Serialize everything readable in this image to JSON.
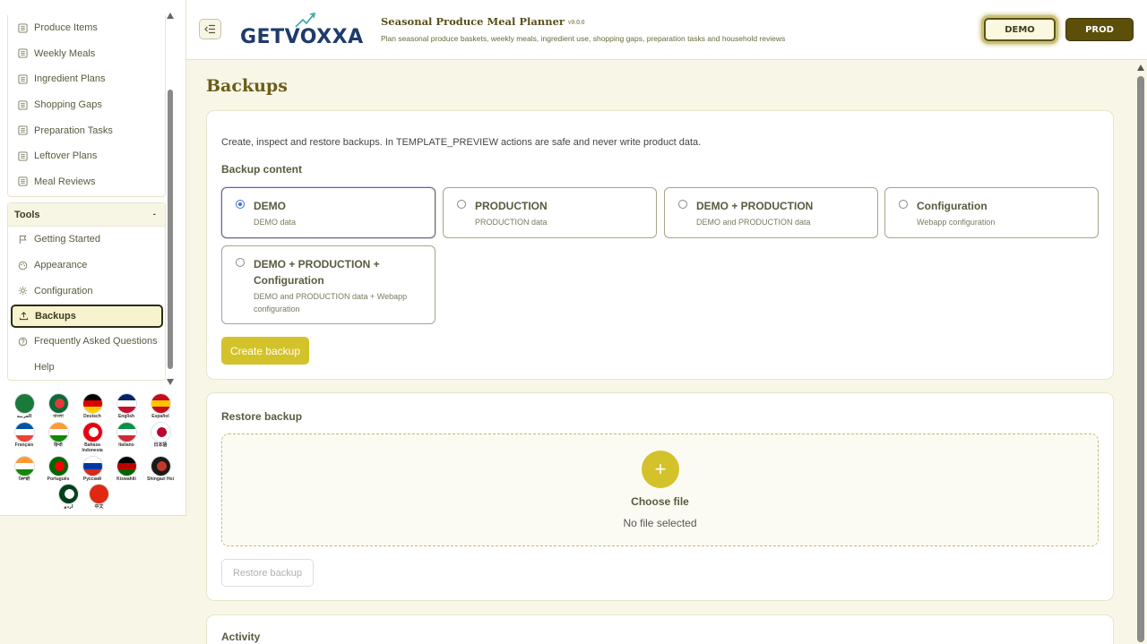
{
  "app": {
    "logo_text": "GETVOXXA",
    "title": "Seasonal Produce Meal Planner",
    "version": "v9.0.0",
    "subtitle": "Plan seasonal produce baskets, weekly meals, ingredient use, shopping gaps, preparation tasks and household reviews"
  },
  "env": {
    "demo": "DEMO",
    "prod": "PROD",
    "active": "DEMO"
  },
  "sidebar": {
    "top_items": [
      {
        "label": "Produce Items",
        "icon": "list-icon"
      },
      {
        "label": "Weekly Meals",
        "icon": "list-icon"
      },
      {
        "label": "Ingredient Plans",
        "icon": "list-icon"
      },
      {
        "label": "Shopping Gaps",
        "icon": "list-icon"
      },
      {
        "label": "Preparation Tasks",
        "icon": "list-icon"
      },
      {
        "label": "Leftover Plans",
        "icon": "list-icon"
      },
      {
        "label": "Meal Reviews",
        "icon": "list-icon"
      }
    ],
    "tools": {
      "title": "Tools",
      "collapse": "-",
      "items": [
        {
          "label": "Getting Started",
          "icon": "flag-icon"
        },
        {
          "label": "Appearance",
          "icon": "palette-icon"
        },
        {
          "label": "Configuration",
          "icon": "gear-icon"
        },
        {
          "label": "Backups",
          "icon": "upload-icon",
          "active": true
        },
        {
          "label": "Frequently Asked Questions",
          "icon": "question-icon"
        },
        {
          "label": "Help",
          "icon": ""
        }
      ]
    }
  },
  "languages": [
    {
      "label": "العربية",
      "colors": [
        "#1a7a3a",
        "#1a7a3a"
      ]
    },
    {
      "label": "বাংলা",
      "colors": [
        "#0a6a3a",
        "#e23a3a"
      ]
    },
    {
      "label": "Deutsch",
      "colors": [
        "#000000",
        "#dd0000",
        "#ffce00"
      ]
    },
    {
      "label": "English",
      "colors": [
        "#012169",
        "#ffffff",
        "#c8102e"
      ]
    },
    {
      "label": "Español",
      "colors": [
        "#c60b1e",
        "#ffc400",
        "#c60b1e"
      ]
    },
    {
      "label": "Français",
      "colors": [
        "#0055a4",
        "#ffffff",
        "#ef4135"
      ]
    },
    {
      "label": "हिन्दी",
      "colors": [
        "#ff9933",
        "#ffffff",
        "#138808"
      ]
    },
    {
      "label": "Bahasa Indonesia",
      "colors": [
        "#e70011",
        "#ffffff"
      ]
    },
    {
      "label": "Italiano",
      "colors": [
        "#009246",
        "#ffffff",
        "#ce2b37"
      ]
    },
    {
      "label": "日本語",
      "colors": [
        "#ffffff",
        "#bc002d"
      ]
    },
    {
      "label": "ਪੰਜਾਬੀ",
      "colors": [
        "#ff9933",
        "#ffffff",
        "#138808"
      ]
    },
    {
      "label": "Português",
      "colors": [
        "#006600",
        "#ff0000"
      ]
    },
    {
      "label": "Русский",
      "colors": [
        "#ffffff",
        "#0039a6",
        "#d52b1e"
      ]
    },
    {
      "label": "Kiswahili",
      "colors": [
        "#000000",
        "#bb0000",
        "#006600"
      ]
    },
    {
      "label": "Shingazi Hoi",
      "colors": [
        "#1a1a1a",
        "#c0392b"
      ]
    },
    {
      "label": "اردو",
      "colors": [
        "#01411c",
        "#ffffff"
      ]
    },
    {
      "label": "中文",
      "colors": [
        "#de2910",
        "#de2910"
      ]
    }
  ],
  "page": {
    "title": "Backups",
    "intro": "Create, inspect and restore backups. In TEMPLATE_PREVIEW actions are safe and never write product data.",
    "backup_content_title": "Backup content",
    "options": [
      {
        "title": "DEMO",
        "desc": "DEMO data",
        "selected": true
      },
      {
        "title": "PRODUCTION",
        "desc": "PRODUCTION data",
        "selected": false
      },
      {
        "title": "DEMO + PRODUCTION",
        "desc": "DEMO and PRODUCTION data",
        "selected": false
      },
      {
        "title": "Configuration",
        "desc": "Webapp configuration",
        "selected": false
      },
      {
        "title": "DEMO + PRODUCTION + Configuration",
        "desc": "DEMO and PRODUCTION data + Webapp configuration",
        "selected": false
      }
    ],
    "create_label": "Create backup",
    "restore_title": "Restore backup",
    "choose_file": "Choose file",
    "no_file": "No file selected",
    "restore_label": "Restore backup",
    "activity_title": "Activity"
  },
  "colors": {
    "accent": "#d4c22a",
    "brand_dark": "#5b4f0a",
    "title": "#6b5d1c"
  }
}
